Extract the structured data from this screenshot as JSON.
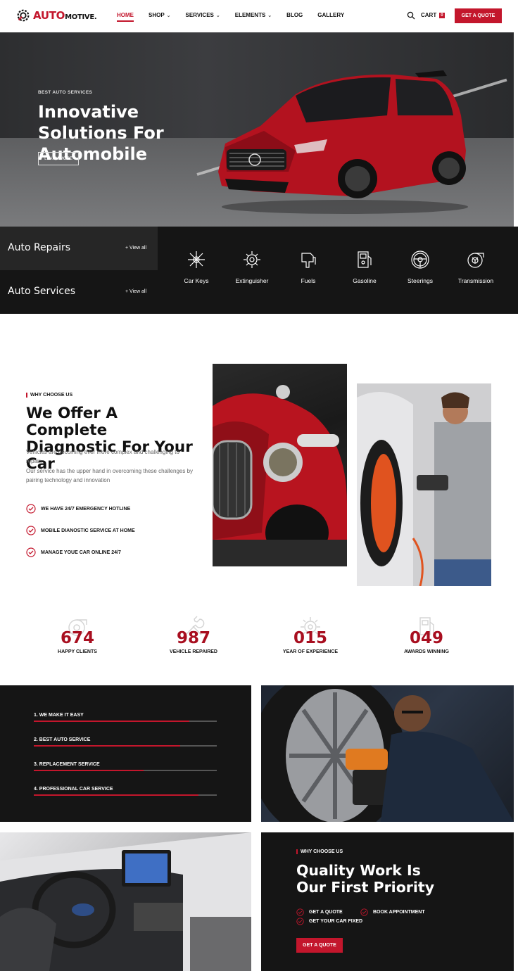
{
  "header": {
    "logo_a": "AUTO",
    "logo_b": "MOTIVE.",
    "nav": [
      {
        "label": "HOME",
        "dropdown": false
      },
      {
        "label": "SHOP",
        "dropdown": true
      },
      {
        "label": "SERVICES",
        "dropdown": true
      },
      {
        "label": "ELEMENTS",
        "dropdown": true
      },
      {
        "label": "BLOG",
        "dropdown": false
      },
      {
        "label": "GALLERY",
        "dropdown": false
      }
    ],
    "cart_label": "CART",
    "cart_count": "0",
    "quote_button": "GET A QUOTE"
  },
  "hero": {
    "kicker": "BEST AUTO SERVICES",
    "title": "Innovative Solutions For Automobile",
    "button": "LEARN MORE"
  },
  "categories": {
    "items": [
      {
        "label": "Auto Repairs",
        "view_all": "+ View all"
      },
      {
        "label": "Auto Services",
        "view_all": "+ View all"
      }
    ],
    "services": [
      {
        "label": "Car Keys",
        "icon": "car-keys-icon"
      },
      {
        "label": "Extinguisher",
        "icon": "extinguisher-icon"
      },
      {
        "label": "Fuels",
        "icon": "fuel-nozzle-icon"
      },
      {
        "label": "Gasoline",
        "icon": "gas-pump-icon"
      },
      {
        "label": "Steerings",
        "icon": "steering-wheel-icon"
      },
      {
        "label": "Transmission",
        "icon": "turbo-icon"
      }
    ]
  },
  "why": {
    "kicker": "WHY CHOOSE US",
    "title": "We Offer A Complete Diagnostic For Your Car",
    "text_1": "Vehicles are becoming ever more complex and challenging to repair.",
    "text_2": "Our service has the upper hand in overcoming these challenges by pairing technology and innovation",
    "checks": [
      "WE HAVE 24/7 EMERGENCY HOTLINE",
      "MOBILE DIANOSTIC SERVICE AT HOME",
      "MANAGE YOUE CAR ONLINE 24/7"
    ]
  },
  "stats": [
    {
      "value": "674",
      "label": "HAPPY CLIENTS",
      "icon": "turbo-icon"
    },
    {
      "value": "987",
      "label": "VEHICLE REPAIRED",
      "icon": "wrench-icon"
    },
    {
      "value": "015",
      "label": "YEAR OF EXPERIENCE",
      "icon": "gear-icon"
    },
    {
      "value": "049",
      "label": "AWARDS WINNING",
      "icon": "fuel-nozzle-icon"
    }
  ],
  "progress": [
    {
      "label": "1. WE MAKE IT EASY",
      "percent": 85
    },
    {
      "label": "2. BEST AUTO SERVICE",
      "percent": 80
    },
    {
      "label": "3. REPLACEMENT SERVICE",
      "percent": 60
    },
    {
      "label": "4. PROFESSIONAL CAR SERVICE",
      "percent": 90
    }
  ],
  "quality": {
    "kicker": "WHY CHOOSE US",
    "title": "Quality Work Is Our First Priority",
    "checks": [
      "GET A QUOTE",
      "BOOK APPOINTMENT",
      "GET YOUR CAR FIXED"
    ],
    "button": "GET A QUOTE"
  },
  "colors": {
    "accent": "#c3162c",
    "dark": "#151515"
  }
}
